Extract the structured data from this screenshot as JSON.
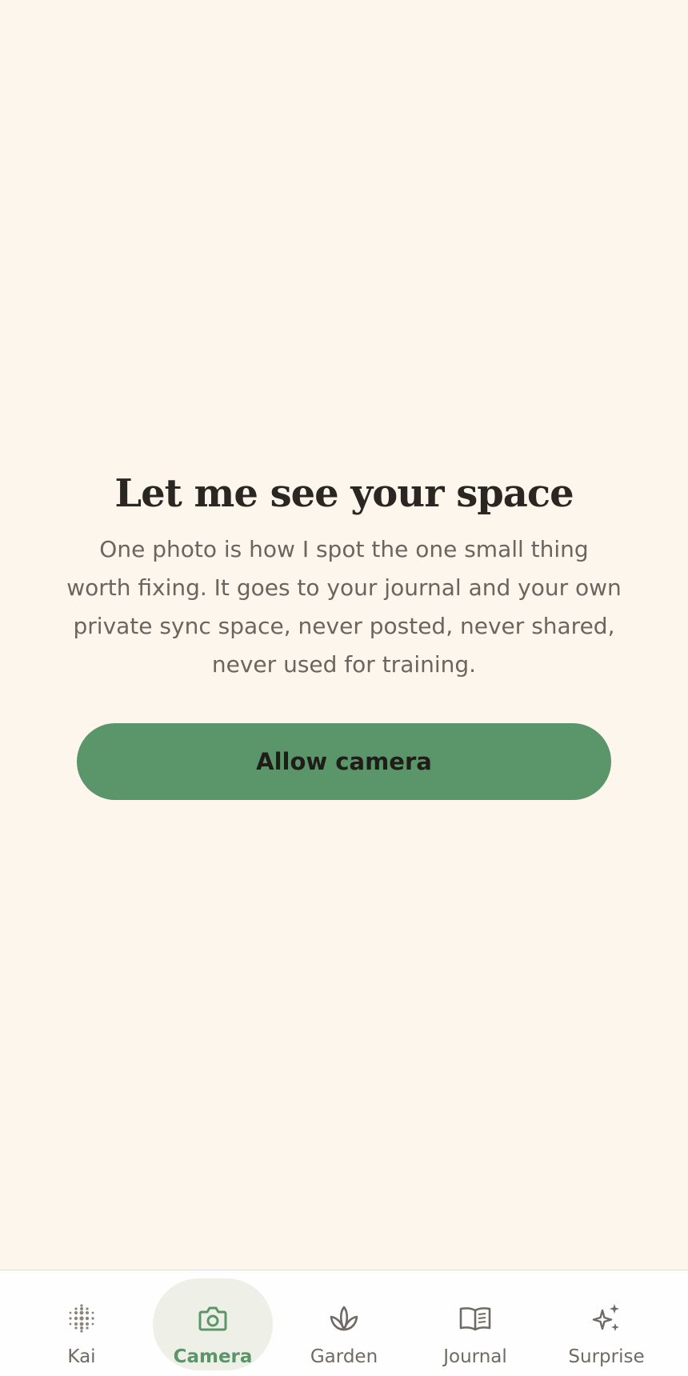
{
  "permission": {
    "title": "Let me see your space",
    "body": "One photo is how I spot the one small thing worth fixing. It goes to your journal and your own private sync space, never posted, never shared, never used for training.",
    "button_label": "Allow camera"
  },
  "tabbar": {
    "active": "Camera",
    "items": [
      {
        "label": "Kai",
        "icon": "dot-grid-icon"
      },
      {
        "label": "Camera",
        "icon": "camera-icon"
      },
      {
        "label": "Garden",
        "icon": "lotus-icon"
      },
      {
        "label": "Journal",
        "icon": "open-book-icon"
      },
      {
        "label": "Surprise",
        "icon": "sparkles-icon"
      }
    ]
  },
  "colors": {
    "background": "#fdf6ec",
    "accent": "#5a9669",
    "title": "#2a2622",
    "body": "#6b6560",
    "tab_inactive": "#6f6a64",
    "tab_active_bg": "#eef0e8"
  }
}
